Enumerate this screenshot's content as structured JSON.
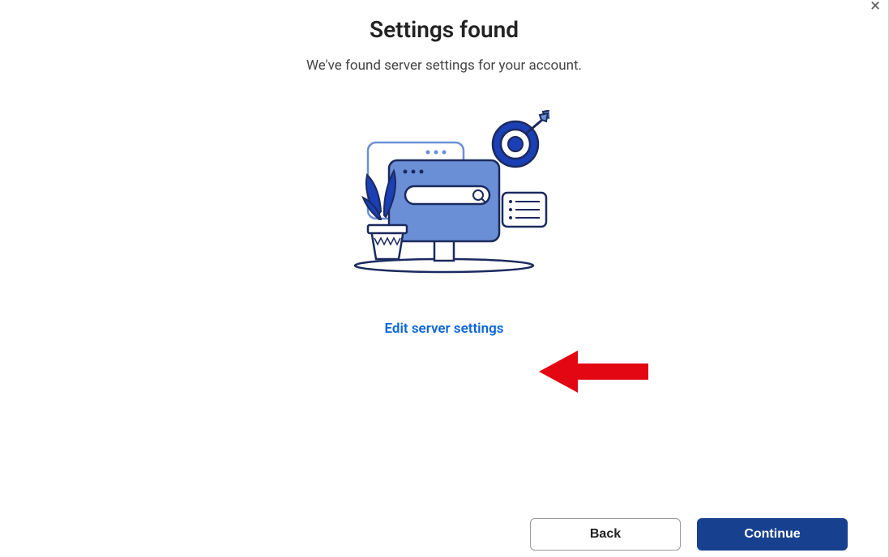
{
  "dialog": {
    "title": "Settings found",
    "subtitle": "We've found server settings for your account.",
    "edit_link_label": "Edit server settings",
    "back_label": "Back",
    "continue_label": "Continue",
    "close_label": "×"
  }
}
